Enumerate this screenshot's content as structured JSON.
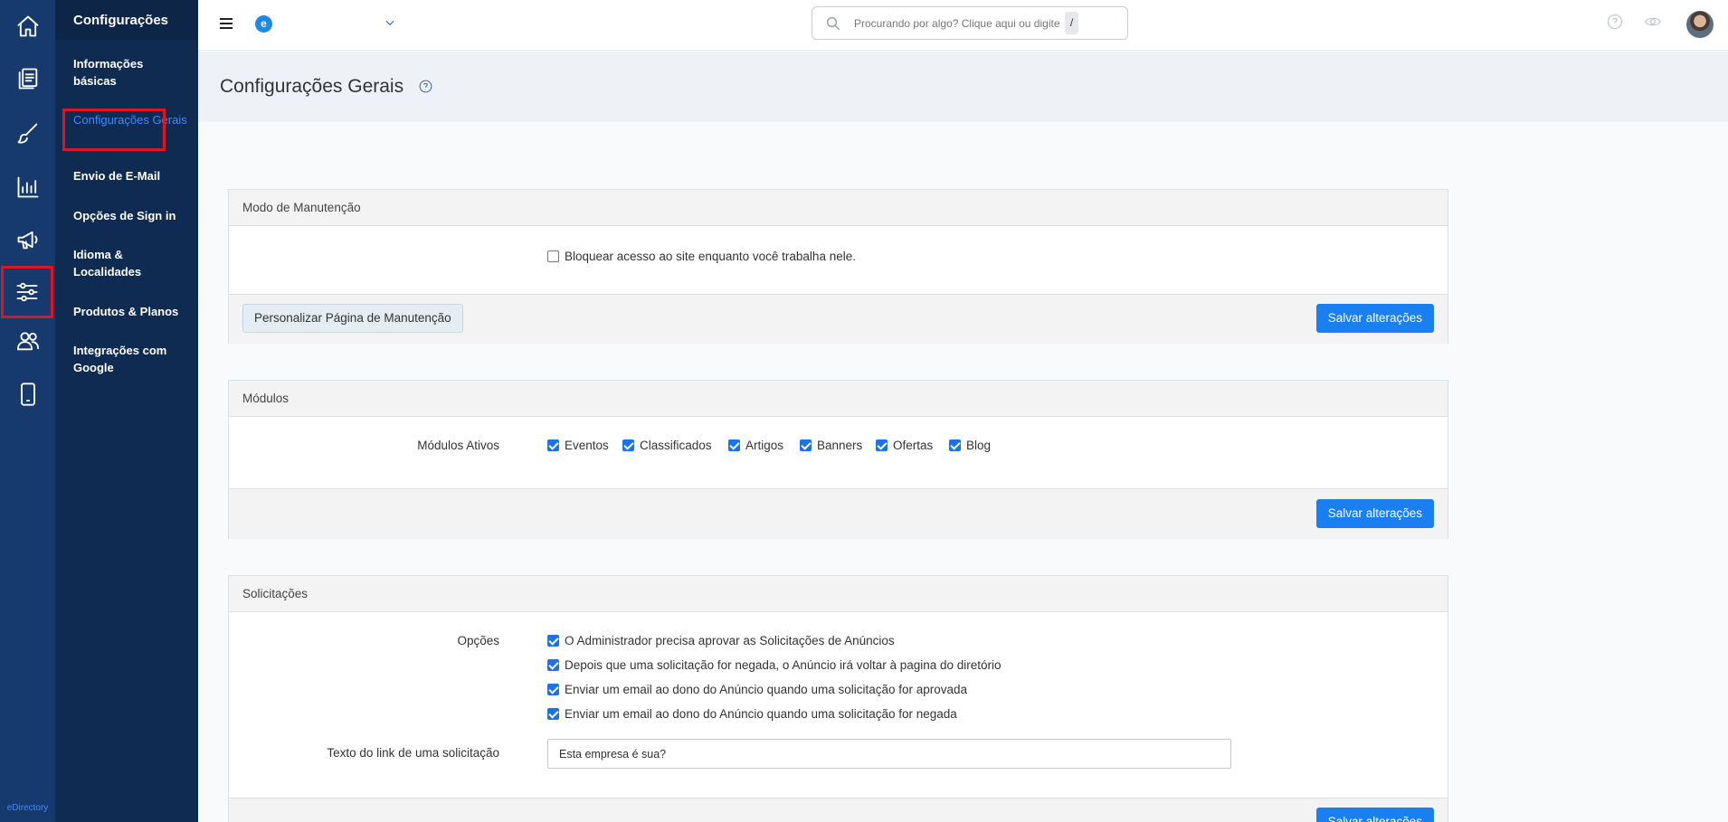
{
  "sidebar_rail": {
    "items": [
      {
        "icon": "home-icon"
      },
      {
        "icon": "listings-icon"
      },
      {
        "icon": "brush-icon"
      },
      {
        "icon": "chart-icon"
      },
      {
        "icon": "megaphone-icon"
      },
      {
        "icon": "settings-sliders-icon",
        "active": true
      },
      {
        "icon": "users-icon"
      },
      {
        "icon": "mobile-icon"
      }
    ],
    "brand": "eDirectory"
  },
  "subnav": {
    "title": "Configurações",
    "items": [
      {
        "label": "Informações básicas"
      },
      {
        "label": "Configurações Gerais",
        "active": true
      },
      {
        "label": "Envio de E-Mail"
      },
      {
        "label": "Opções de Sign in"
      },
      {
        "label": "Idioma & Localidades"
      },
      {
        "label": "Produtos & Planos"
      },
      {
        "label": "Integrações com Google"
      }
    ]
  },
  "topbar": {
    "brand_letter": "e",
    "search_placeholder": "Procurando por algo? Clique aqui ou digite",
    "search_shortcut": "/"
  },
  "page": {
    "title": "Configurações Gerais"
  },
  "maintenance": {
    "heading": "Modo de Manutenção",
    "checkbox_label": "Bloquear acesso ao site enquanto você trabalha nele.",
    "checked": false,
    "customize_button": "Personalizar Página de Manutenção",
    "save_button": "Salvar alterações"
  },
  "modules": {
    "heading": "Módulos",
    "row_label": "Módulos Ativos",
    "items": [
      {
        "label": "Eventos",
        "checked": true
      },
      {
        "label": "Classificados",
        "checked": true
      },
      {
        "label": "Artigos",
        "checked": true
      },
      {
        "label": "Banners",
        "checked": true
      },
      {
        "label": "Ofertas",
        "checked": true
      },
      {
        "label": "Blog",
        "checked": true
      }
    ],
    "save_button": "Salvar alterações"
  },
  "requests": {
    "heading": "Solicitações",
    "options_label": "Opções",
    "options": [
      {
        "label": "O Administrador precisa aprovar as Solicitações de Anúncios",
        "checked": true
      },
      {
        "label": "Depois que uma solicitação for negada, o Anúncio irá voltar à pagina do diretório",
        "checked": true
      },
      {
        "label": "Enviar um email ao dono do Anúncio quando uma solicitação for aprovada",
        "checked": true
      },
      {
        "label": "Enviar um email ao dono do Anúncio quando uma solicitação for negada",
        "checked": true
      }
    ],
    "link_text_label": "Texto do link de uma solicitação",
    "link_text_value": "Esta empresa é sua?",
    "save_button": "Salvar alterações"
  },
  "colors": {
    "rail_bg": "#163a6e",
    "subnav_bg": "#102b52",
    "primary": "#1a7ff0",
    "highlight": "#e0141e"
  }
}
